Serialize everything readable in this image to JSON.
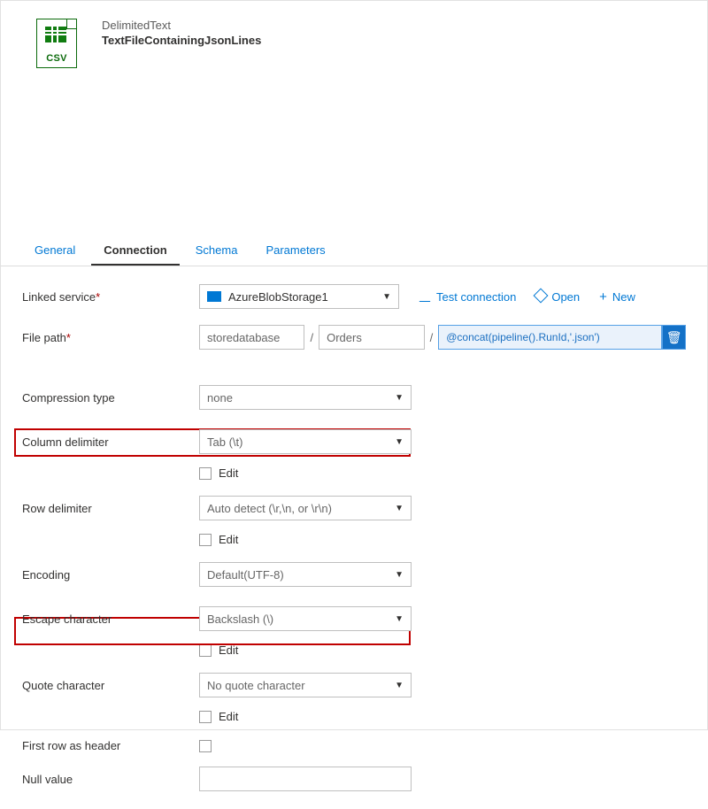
{
  "header": {
    "icon_label": "CSV",
    "type_label": "DelimitedText",
    "name": "TextFileContainingJsonLines"
  },
  "tabs": {
    "general": "General",
    "connection": "Connection",
    "schema": "Schema",
    "parameters": "Parameters"
  },
  "form": {
    "linked_service": {
      "label": "Linked service",
      "value": "AzureBlobStorage1",
      "test_connection": "Test connection",
      "open": "Open",
      "new": "New"
    },
    "file_path": {
      "label": "File path",
      "container": "storedatabase",
      "directory": "Orders",
      "expression": "@concat(pipeline().RunId,'.json')"
    },
    "compression_type": {
      "label": "Compression type",
      "value": "none"
    },
    "column_delimiter": {
      "label": "Column delimiter",
      "value": "Tab (\\t)",
      "edit": "Edit"
    },
    "row_delimiter": {
      "label": "Row delimiter",
      "value": "Auto detect (\\r,\\n, or \\r\\n)",
      "edit": "Edit"
    },
    "encoding": {
      "label": "Encoding",
      "value": "Default(UTF-8)"
    },
    "escape_character": {
      "label": "Escape character",
      "value": "Backslash (\\)",
      "edit": "Edit"
    },
    "quote_character": {
      "label": "Quote character",
      "value": "No quote character",
      "edit": "Edit"
    },
    "first_row_as_header": {
      "label": "First row as header"
    },
    "null_value": {
      "label": "Null value",
      "value": ""
    }
  }
}
